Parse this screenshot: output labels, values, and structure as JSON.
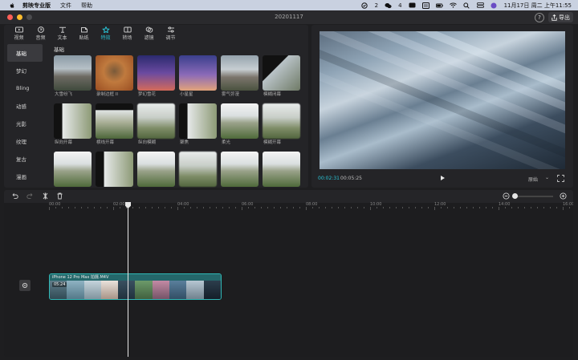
{
  "menubar": {
    "app_name": "剪映专业版",
    "items": [
      "文件",
      "帮助"
    ],
    "notif_count": "2",
    "chat_count": "4",
    "datetime": "11月17日 周二 上午11:55"
  },
  "window": {
    "title": "20201117",
    "export_label": "导出"
  },
  "media": {
    "tabs": [
      {
        "label": "视频",
        "icon": "video-icon"
      },
      {
        "label": "音频",
        "icon": "audio-icon"
      },
      {
        "label": "文本",
        "icon": "text-icon"
      },
      {
        "label": "贴纸",
        "icon": "sticker-icon"
      },
      {
        "label": "特效",
        "icon": "effects-icon",
        "active": true
      },
      {
        "label": "转场",
        "icon": "transition-icon"
      },
      {
        "label": "滤镜",
        "icon": "filter-icon"
      },
      {
        "label": "调节",
        "icon": "adjust-icon"
      }
    ],
    "categories": [
      "基础",
      "梦幻",
      "Bling",
      "动感",
      "光影",
      "纹理",
      "复古",
      "漫画"
    ],
    "active_category": "基础",
    "section_title": "基础",
    "effects": [
      {
        "label": "大雪纷飞",
        "style": "bg-mountain"
      },
      {
        "label": "录制边框 II",
        "style": "bg-tv"
      },
      {
        "label": "梦幻雪花",
        "style": "bg-dream"
      },
      {
        "label": "小星星",
        "style": "bg-dream2"
      },
      {
        "label": "雾气弥漫",
        "style": "bg-mountain2"
      },
      {
        "label": "模糊闭幕",
        "style": "bg-split"
      },
      {
        "label": "纵向开幕",
        "style": "bg-split-v"
      },
      {
        "label": "横线开幕",
        "style": "bg-field-dark"
      },
      {
        "label": "纵向模糊",
        "style": "bg-field-blur"
      },
      {
        "label": "聚焦",
        "style": "bg-split-v"
      },
      {
        "label": "柔光",
        "style": "bg-field"
      },
      {
        "label": "模糊开幕",
        "style": "bg-field-blur"
      },
      {
        "label": "",
        "style": "bg-field"
      },
      {
        "label": "",
        "style": "bg-split-v"
      },
      {
        "label": "",
        "style": "bg-field"
      },
      {
        "label": "",
        "style": "bg-field-blur"
      },
      {
        "label": "",
        "style": "bg-field"
      },
      {
        "label": "",
        "style": "bg-field"
      }
    ]
  },
  "preview": {
    "current_time": "00:02:31",
    "total_time": "00:05:25",
    "ratio_label": "原始"
  },
  "timeline": {
    "ruler_labels": [
      "00:00",
      "02:00",
      "04:00",
      "06:00",
      "08:00",
      "10:00",
      "12:00",
      "14:00",
      "16:00"
    ],
    "clip": {
      "title": "iPhone 12 Pro Max 拍摄.M4V",
      "duration": "05:24"
    }
  },
  "colors": {
    "accent": "#29c4d6",
    "clip_border": "#2fb7b5",
    "bg": "#1e1e20",
    "panel": "#242427"
  }
}
